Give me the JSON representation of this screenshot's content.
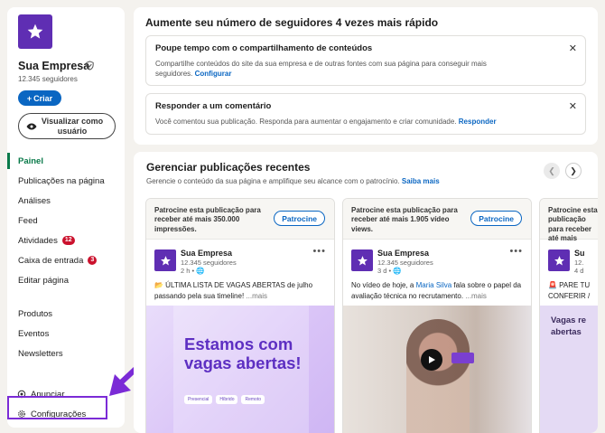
{
  "sidebar": {
    "company_name": "Sua Empresa",
    "followers": "12.345 seguidores",
    "create_label": "Criar",
    "view_as_member_label": "Visualizar como usuário",
    "nav": [
      {
        "label": "Painel",
        "active": true
      },
      {
        "label": "Publicações na página"
      },
      {
        "label": "Análises"
      },
      {
        "label": "Feed"
      },
      {
        "label": "Atividades",
        "badge": "12"
      },
      {
        "label": "Caixa de entrada",
        "badge": "3"
      },
      {
        "label": "Editar página"
      }
    ],
    "nav_secondary": [
      {
        "label": "Produtos"
      },
      {
        "label": "Eventos"
      },
      {
        "label": "Newsletters"
      }
    ],
    "advertise_label": "Anunciar",
    "settings_label": "Configurações"
  },
  "growth": {
    "title": "Aumente seu número de seguidores 4 vezes mais rápido",
    "notices": [
      {
        "title": "Poupe tempo com o compartilhamento de conteúdos",
        "text": "Compartilhe conteúdos do site da sua empresa e de outras fontes com sua página para conseguir mais seguidores.",
        "link": "Configurar"
      },
      {
        "title": "Responder a um comentário",
        "text": "Você comentou sua publicação. Responda para aumentar o engajamento e criar comunidade.",
        "link": "Responder"
      }
    ]
  },
  "posts_section": {
    "title": "Gerenciar publicações recentes",
    "subtitle": "Gerencie o conteúdo da sua página e amplifique seu alcance com o patrocínio.",
    "learn_more": "Saiba mais",
    "posts": [
      {
        "sponsor_text": "Patrocine esta publicação para receber até mais 350.000 impressões.",
        "sponsor_button": "Patrocine",
        "author": "Sua Empresa",
        "followers": "12.345 seguidores",
        "time": "2 h •",
        "text": "📂 ÚLTIMA LISTA DE VAGAS ABERTAS de julho passando pela sua timeline!",
        "more": "...mais",
        "image_headline": "Estamos com vagas abertas!",
        "image_tags": [
          "Presencial",
          "Híbrido",
          "Remoto"
        ]
      },
      {
        "sponsor_text": "Patrocine esta publicação para receber até mais 1.905 vídeo views.",
        "sponsor_button": "Patrocine",
        "author": "Sua Empresa",
        "followers": "12.345 seguidores",
        "time": "3 d •",
        "text_before": "No vídeo de hoje, a ",
        "mention": "Maria Silva",
        "text_after": " fala sobre o papel da avaliação técnica no recrutamento.",
        "more": "...mais"
      },
      {
        "sponsor_text": "Patrocine esta publicação para receber até mais",
        "author": "Su",
        "followers": "12.",
        "time": "4 d",
        "text": "🚨 PARE TU CONFERIR /",
        "image_headline": "Vagas re abertas"
      }
    ]
  },
  "colors": {
    "brand_purple": "#5f2eb3",
    "link_blue": "#0a66c2",
    "active_green": "#0a7a4a",
    "highlight_purple": "#7b2bd6",
    "badge_red": "#cb112d"
  }
}
